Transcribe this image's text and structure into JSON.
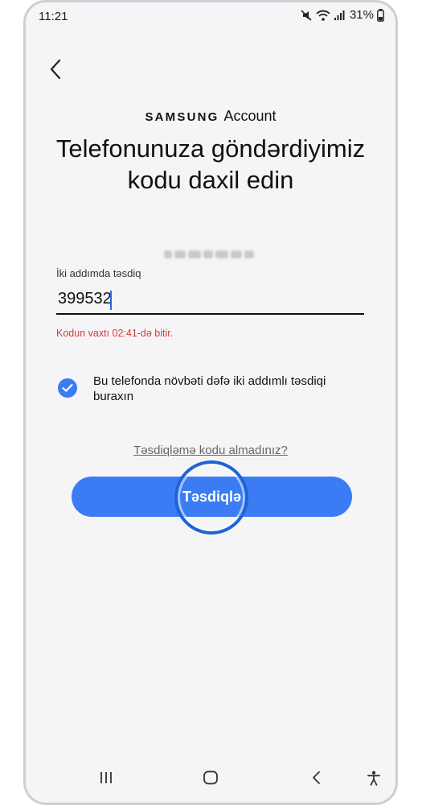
{
  "status": {
    "time": "11:21",
    "battery": "31%",
    "icons": [
      "mute-icon",
      "wifi-icon",
      "signal-icon",
      "battery-icon"
    ]
  },
  "brand": {
    "samsung": "SAMSUNG",
    "account": "Account"
  },
  "title": "Telefonunuza göndərdiyimiz kodu daxil edin",
  "verification": {
    "label": "İki addımda təsdiq",
    "code_value": "399532",
    "error": "Kodun vaxtı 02:41-də bitir."
  },
  "remember": {
    "checked": true,
    "label": "Bu telefonda növbəti dəfə iki addımlı təsdiqi buraxın"
  },
  "help_link": "Təsdiqləmə kodu almadınız?",
  "confirm_button": "Təsdiqlə",
  "colors": {
    "accent": "#3b7cf4",
    "error": "#d63a3a",
    "ring": "#1e63d8"
  },
  "nav": [
    "recent-apps-icon",
    "home-icon",
    "back-icon",
    "accessibility-icon"
  ]
}
